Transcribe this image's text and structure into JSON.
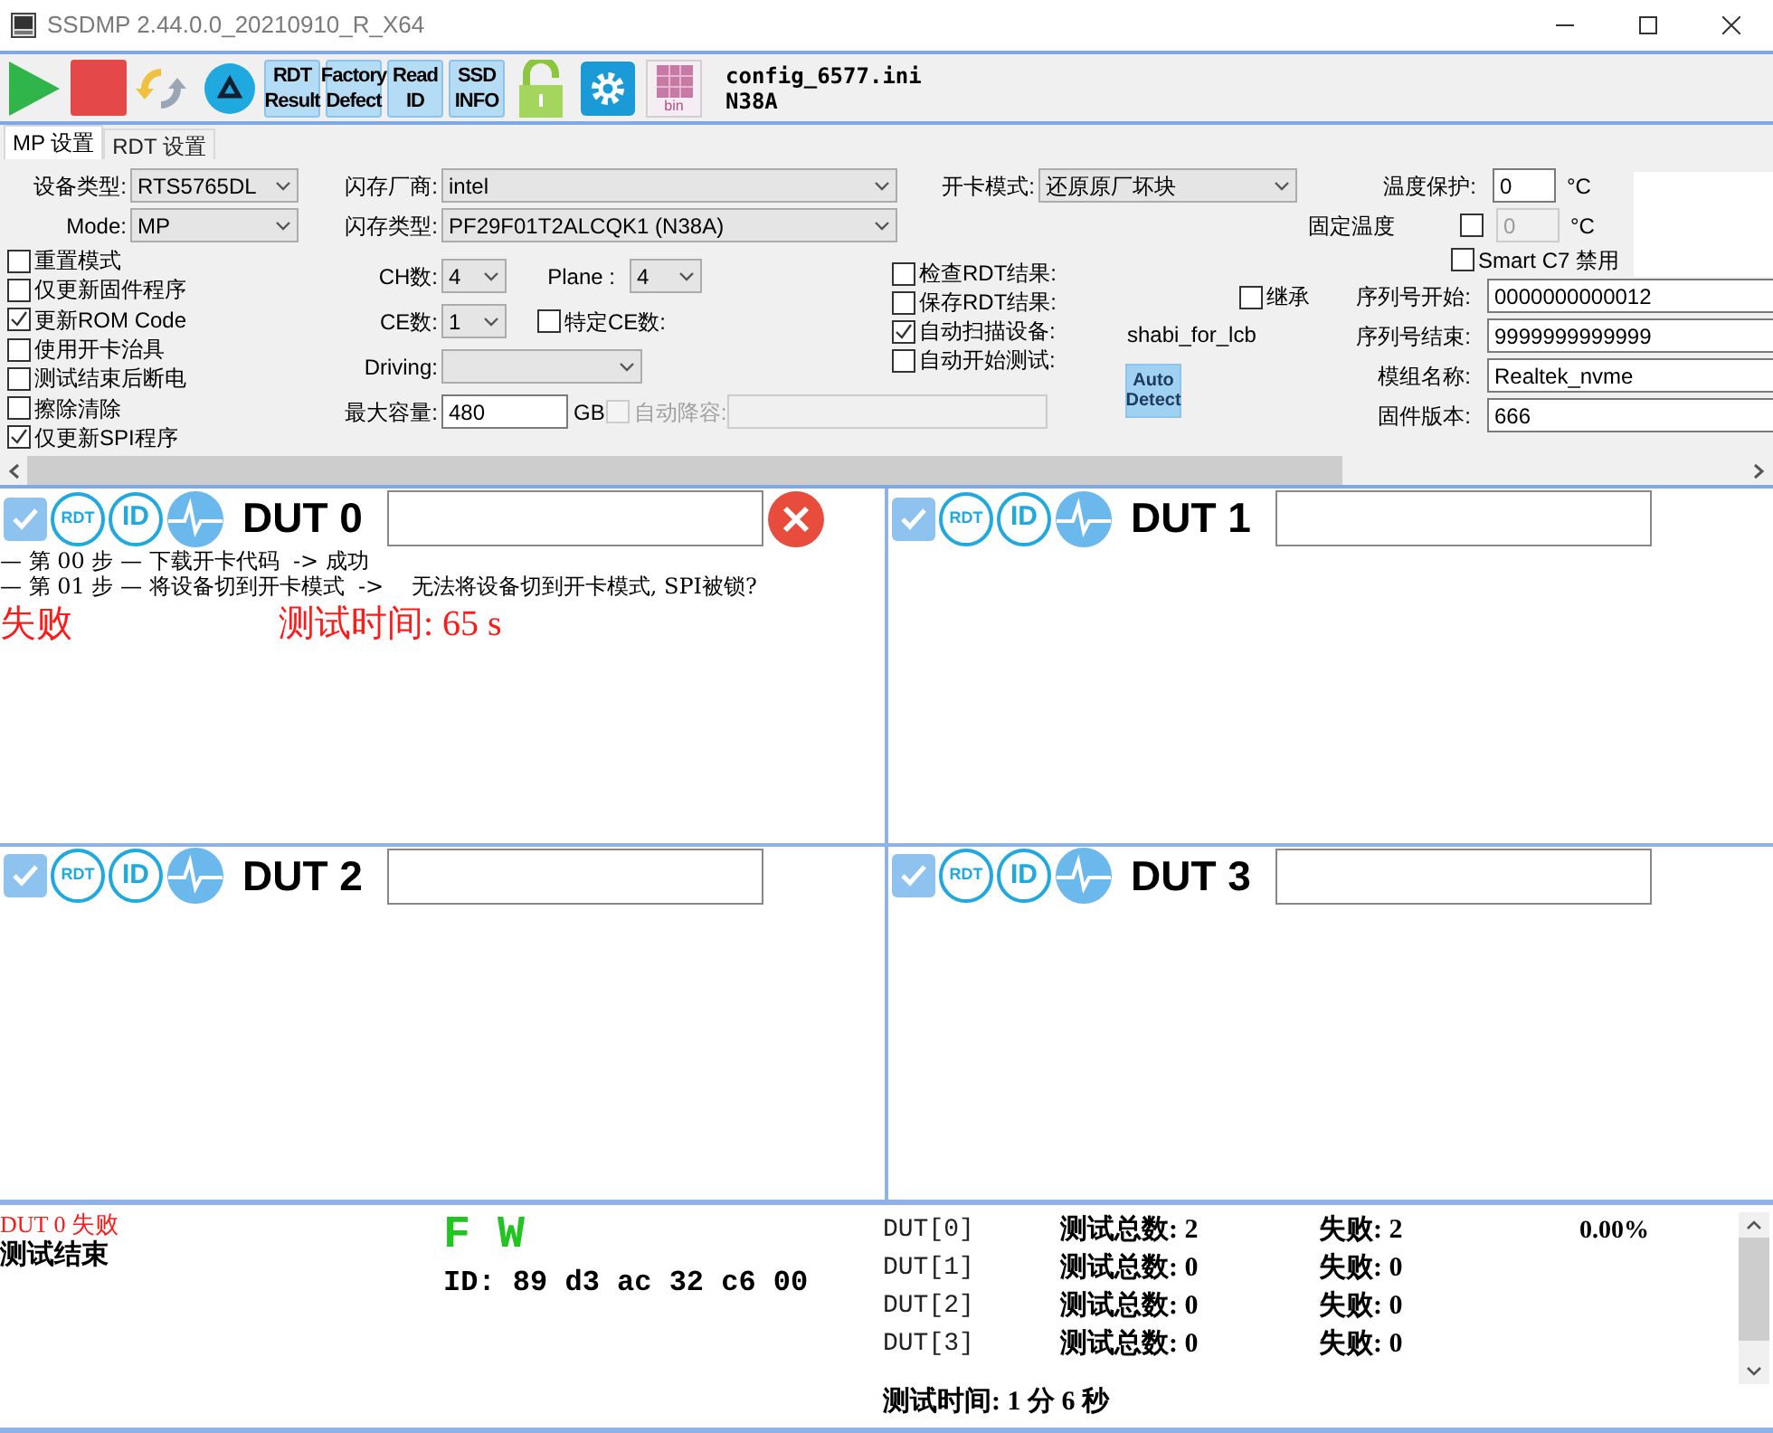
{
  "window": {
    "title": "SSDMP 2.44.0.0_20210910_R_X64"
  },
  "toolbar": {
    "buttons": [
      {
        "kind": "play"
      },
      {
        "kind": "stop"
      },
      {
        "kind": "refresh"
      },
      {
        "kind": "recycle"
      },
      {
        "kind": "text",
        "lines": [
          "RDT",
          "Result"
        ]
      },
      {
        "kind": "text",
        "lines": [
          "Factory",
          "Defect"
        ]
      },
      {
        "kind": "text",
        "lines": [
          "Read",
          "ID"
        ]
      },
      {
        "kind": "text",
        "lines": [
          "SSD",
          "INFO"
        ]
      },
      {
        "kind": "lock"
      },
      {
        "kind": "gear"
      },
      {
        "kind": "bin",
        "label": "bin"
      }
    ],
    "config_file": "config_6577.ini",
    "flash_name": "N38A"
  },
  "tabs": [
    {
      "label": "MP 设置",
      "selected": true
    },
    {
      "label": "RDT 设置",
      "selected": false
    }
  ],
  "settings": {
    "device_type": {
      "label": "设备类型:",
      "value": "RTS5765DL"
    },
    "mode": {
      "label": "Mode:",
      "value": "MP"
    },
    "options": [
      {
        "label": "重置模式",
        "checked": false
      },
      {
        "label": "仅更新固件程序",
        "checked": false
      },
      {
        "label": "更新ROM Code",
        "checked": true
      },
      {
        "label": "使用开卡治具",
        "checked": false
      },
      {
        "label": "测试结束后断电",
        "checked": false
      },
      {
        "label": "擦除清除",
        "checked": false
      },
      {
        "label": "仅更新SPI程序",
        "checked": true
      }
    ],
    "flash_vendor": {
      "label": "闪存厂商:",
      "value": "intel"
    },
    "flash_type": {
      "label": "闪存类型:",
      "value": "PF29F01T2ALCQK1 (N38A)"
    },
    "ch_count": {
      "label": "CH数:",
      "value": "4"
    },
    "plane": {
      "label": "Plane :",
      "value": "4"
    },
    "ce_count": {
      "label": "CE数:",
      "value": "1"
    },
    "specific_ce": {
      "label": "特定CE数:",
      "checked": false
    },
    "driving": {
      "label": "Driving:"
    },
    "max_capacity": {
      "label": "最大容量:",
      "value": "480",
      "unit": "GB"
    },
    "auto_downsize": {
      "label": "自动降容:",
      "checked": false,
      "disabled": true
    },
    "rdt_options": [
      {
        "label": "检查RDT结果:",
        "checked": false
      },
      {
        "label": "保存RDT结果:",
        "checked": false
      },
      {
        "label": "自动扫描设备:",
        "checked": true
      },
      {
        "label": "自动开始测试:",
        "checked": false
      }
    ],
    "open_mode": {
      "label": "开卡模式:",
      "value": "还原原厂坏块"
    },
    "temp_protect": {
      "label": "温度保护:",
      "value": "0",
      "unit": "°C"
    },
    "fixed_temp": {
      "label": "固定温度",
      "checked": false,
      "value": "0",
      "unit": "°C",
      "disabled": true
    },
    "smart_c7": {
      "label": "Smart C7 禁用",
      "checked": false
    },
    "inherit": {
      "label": "继承",
      "checked": false
    },
    "note": "shabi_for_lcb",
    "auto_detect": [
      "Auto",
      "Detect"
    ],
    "fields": [
      {
        "label": "序列号开始:",
        "value": "0000000000012"
      },
      {
        "label": "序列号结束:",
        "value": "9999999999999"
      },
      {
        "label": "模组名称:",
        "value": "Realtek_nvme"
      },
      {
        "label": "固件版本:",
        "value": "666"
      }
    ]
  },
  "duts": [
    {
      "name": "DUT 0",
      "checked": true,
      "badges": [
        "RDT",
        "ID"
      ],
      "error": true,
      "log": [
        "— 第 00 步 — 下载开卡代码  -> 成功",
        "— 第 01 步 — 将设备切到开卡模式  ->    无法将设备切到开卡模式, SPI被锁?"
      ],
      "result": "失败",
      "time": "测试时间: 65 s"
    },
    {
      "name": "DUT 1",
      "checked": true,
      "badges": [
        "RDT",
        "ID"
      ],
      "error": false
    },
    {
      "name": "DUT 2",
      "checked": true,
      "badges": [
        "RDT",
        "ID"
      ],
      "error": false
    },
    {
      "name": "DUT 3",
      "checked": true,
      "badges": [
        "RDT",
        "ID"
      ],
      "error": false
    }
  ],
  "summary": {
    "log": [
      {
        "kind": "error",
        "text": "DUT 0 失败"
      },
      {
        "kind": "done",
        "text": "测试结束"
      }
    ],
    "flags": "F W",
    "chip_id": "ID: 89 d3 ac 32 c6 00",
    "stats": [
      {
        "name": "DUT[0]",
        "total": "测试总数: 2",
        "fail": "失败: 2",
        "rate": "0.00%"
      },
      {
        "name": "DUT[1]",
        "total": "测试总数: 0",
        "fail": "失败: 0"
      },
      {
        "name": "DUT[2]",
        "total": "测试总数: 0",
        "fail": "失败: 0"
      },
      {
        "name": "DUT[3]",
        "total": "测试总数: 0",
        "fail": "失败: 0"
      }
    ],
    "total_time": "测试时间: 1 分 6 秒"
  }
}
